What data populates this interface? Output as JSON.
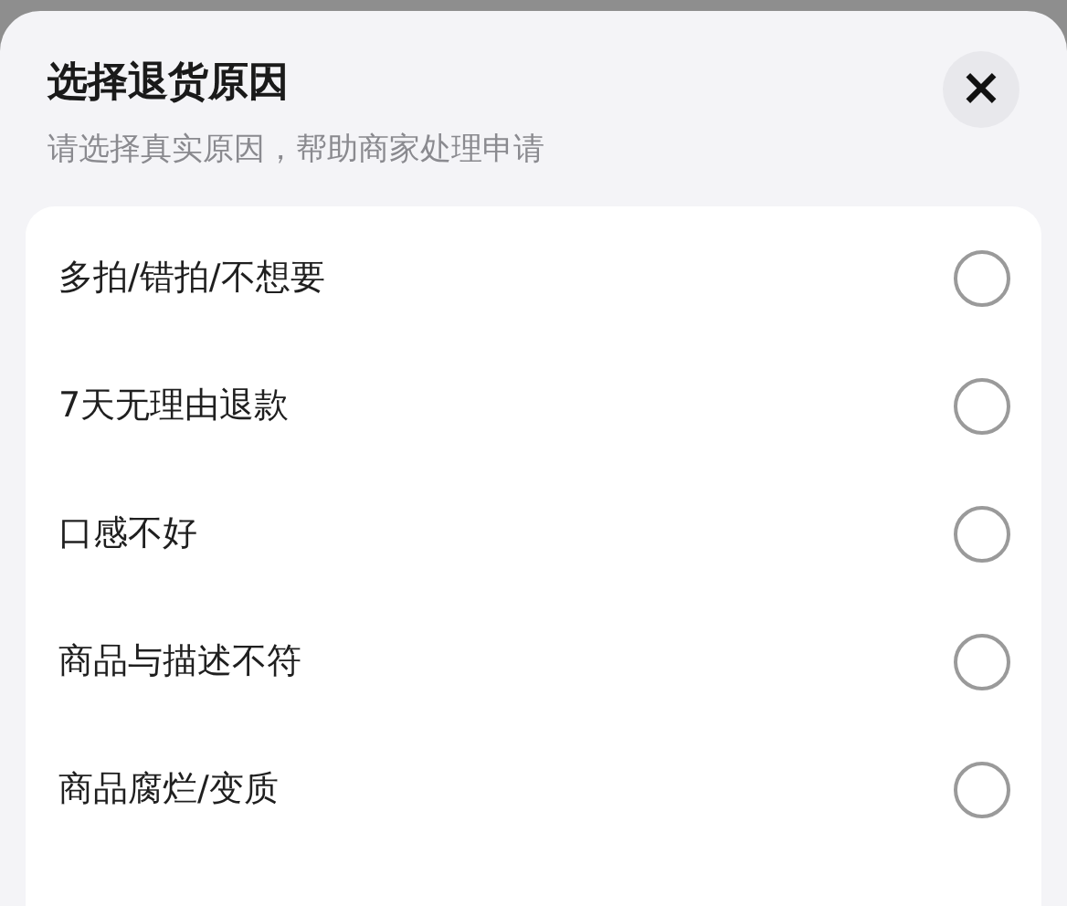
{
  "sheet": {
    "title": "选择退货原因",
    "subtitle": "请选择真实原因，帮助商家处理申请",
    "close": "×"
  },
  "reasons": [
    {
      "label": "多拍/错拍/不想要",
      "selected": false
    },
    {
      "label": "7天无理由退款",
      "selected": false
    },
    {
      "label": "口感不好",
      "selected": false
    },
    {
      "label": "商品与描述不符",
      "selected": false
    },
    {
      "label": "商品腐烂/变质",
      "selected": false
    }
  ]
}
